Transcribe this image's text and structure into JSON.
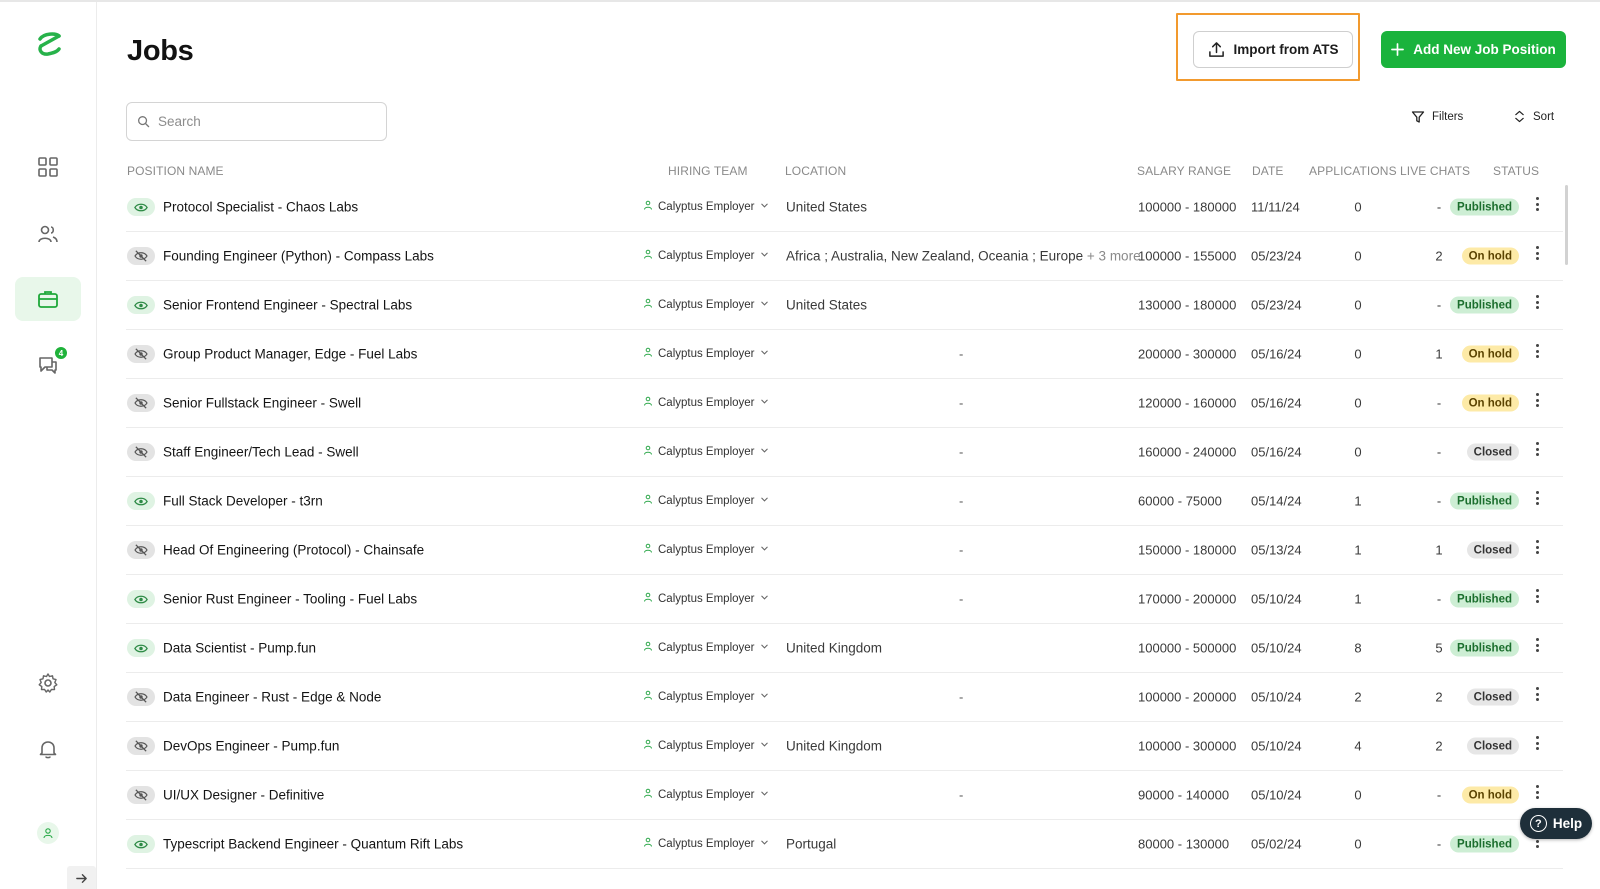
{
  "page": {
    "title": "Jobs"
  },
  "header": {
    "import_label": "Import from ATS",
    "add_label": "Add New Job Position"
  },
  "search": {
    "placeholder": "Search"
  },
  "toolbar": {
    "filters_label": "Filters",
    "sort_label": "Sort"
  },
  "sidebar": {
    "items": [
      {
        "name": "dashboard",
        "icon": "grid-icon",
        "active": false
      },
      {
        "name": "candidates",
        "icon": "users-icon",
        "active": false
      },
      {
        "name": "jobs",
        "icon": "briefcase-icon",
        "active": true
      },
      {
        "name": "messages",
        "icon": "chat-icon",
        "active": false,
        "badge": "4"
      }
    ],
    "bottom": [
      "gear-icon",
      "bell-icon",
      "avatar",
      "arrow-right-icon"
    ]
  },
  "table": {
    "headers": {
      "position": "POSITION NAME",
      "team": "HIRING TEAM",
      "location": "LOCATION",
      "salary": "SALARY RANGE",
      "date": "DATE",
      "applications": "APPLICATIONS",
      "chats": "LIVE CHATS",
      "status": "STATUS"
    },
    "rows": [
      {
        "visible": true,
        "name": "Protocol Specialist - Chaos Labs",
        "team": "Calyptus Employer",
        "location": "United States",
        "more": "",
        "salary": "100000 - 180000",
        "date": "11/11/24",
        "apps": "0",
        "chats": "-",
        "status": "Published"
      },
      {
        "visible": false,
        "name": "Founding Engineer (Python) - Compass Labs",
        "team": "Calyptus Employer",
        "location": "Africa ; Australia, New Zealand, Oceania ; Europe",
        "more": "+ 3 more",
        "salary": "100000 - 155000",
        "date": "05/23/24",
        "apps": "0",
        "chats": "2",
        "status": "On hold"
      },
      {
        "visible": true,
        "name": "Senior Frontend Engineer - Spectral Labs",
        "team": "Calyptus Employer",
        "location": "United States",
        "more": "",
        "salary": "130000 - 180000",
        "date": "05/23/24",
        "apps": "0",
        "chats": "-",
        "status": "Published"
      },
      {
        "visible": false,
        "name": "Group Product Manager, Edge - Fuel Labs",
        "team": "Calyptus Employer",
        "location": "-",
        "more": "",
        "salary": "200000 - 300000",
        "date": "05/16/24",
        "apps": "0",
        "chats": "1",
        "status": "On hold"
      },
      {
        "visible": false,
        "name": "Senior Fullstack Engineer - Swell",
        "team": "Calyptus Employer",
        "location": "-",
        "more": "",
        "salary": "120000 - 160000",
        "date": "05/16/24",
        "apps": "0",
        "chats": "-",
        "status": "On hold"
      },
      {
        "visible": false,
        "name": "Staff Engineer/Tech Lead - Swell",
        "team": "Calyptus Employer",
        "location": "-",
        "more": "",
        "salary": "160000 - 240000",
        "date": "05/16/24",
        "apps": "0",
        "chats": "-",
        "status": "Closed"
      },
      {
        "visible": true,
        "name": "Full Stack Developer - t3rn",
        "team": "Calyptus Employer",
        "location": "-",
        "more": "",
        "salary": "60000 - 75000",
        "date": "05/14/24",
        "apps": "1",
        "chats": "-",
        "status": "Published"
      },
      {
        "visible": false,
        "name": "Head Of Engineering (Protocol) - Chainsafe",
        "team": "Calyptus Employer",
        "location": "-",
        "more": "",
        "salary": "150000 - 180000",
        "date": "05/13/24",
        "apps": "1",
        "chats": "1",
        "status": "Closed"
      },
      {
        "visible": true,
        "name": "Senior Rust Engineer - Tooling - Fuel Labs",
        "team": "Calyptus Employer",
        "location": "-",
        "more": "",
        "salary": "170000 - 200000",
        "date": "05/10/24",
        "apps": "1",
        "chats": "-",
        "status": "Published"
      },
      {
        "visible": true,
        "name": "Data Scientist - Pump.fun",
        "team": "Calyptus Employer",
        "location": "United Kingdom",
        "more": "",
        "salary": "100000 - 500000",
        "date": "05/10/24",
        "apps": "8",
        "chats": "5",
        "status": "Published"
      },
      {
        "visible": false,
        "name": "Data Engineer - Rust - Edge & Node",
        "team": "Calyptus Employer",
        "location": "-",
        "more": "",
        "salary": "100000 - 200000",
        "date": "05/10/24",
        "apps": "2",
        "chats": "2",
        "status": "Closed"
      },
      {
        "visible": false,
        "name": "DevOps Engineer - Pump.fun",
        "team": "Calyptus Employer",
        "location": "United Kingdom",
        "more": "",
        "salary": "100000 - 300000",
        "date": "05/10/24",
        "apps": "4",
        "chats": "2",
        "status": "Closed"
      },
      {
        "visible": false,
        "name": "UI/UX Designer - Definitive",
        "team": "Calyptus Employer",
        "location": "-",
        "more": "",
        "salary": "90000 - 140000",
        "date": "05/10/24",
        "apps": "0",
        "chats": "-",
        "status": "On hold"
      },
      {
        "visible": true,
        "name": "Typescript Backend Engineer - Quantum Rift Labs",
        "team": "Calyptus Employer",
        "location": "Portugal",
        "more": "",
        "salary": "80000 - 130000",
        "date": "05/02/24",
        "apps": "0",
        "chats": "-",
        "status": "Published"
      }
    ]
  },
  "help": {
    "label": "Help"
  },
  "colors": {
    "accent": "#1ab33c",
    "highlight": "#f29a2e",
    "published": "#cdeed4",
    "onhold": "#fdeaa7",
    "closed": "#e6e6e6"
  }
}
